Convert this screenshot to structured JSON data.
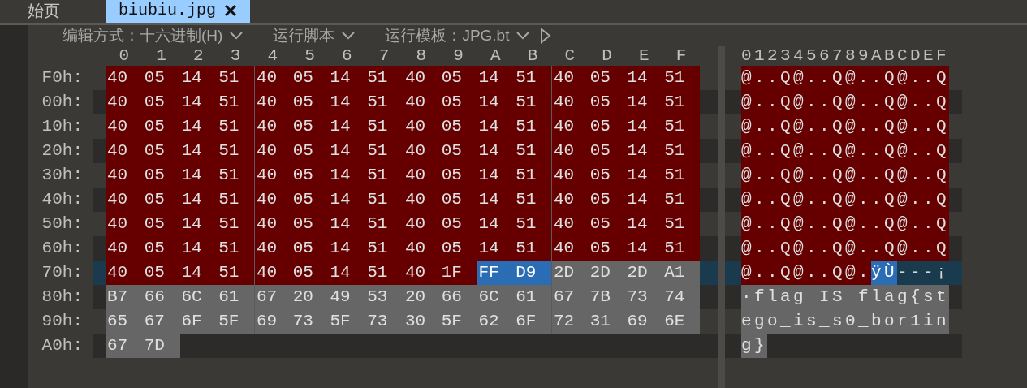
{
  "tabs": [
    {
      "label": "始页",
      "selected": false,
      "closable": false
    },
    {
      "label": "biubiu.jpg",
      "selected": true,
      "closable": true
    }
  ],
  "toolbar": [
    {
      "label": "编辑方式：十六进制(H)",
      "dropdown": true
    },
    {
      "label": "运行脚本",
      "dropdown": true
    },
    {
      "label": "运行模板：JPG.bt",
      "dropdown": true
    }
  ],
  "hex_header": [
    "0",
    "1",
    "2",
    "3",
    "4",
    "5",
    "6",
    "7",
    "8",
    "9",
    "A",
    "B",
    "C",
    "D",
    "E",
    "F"
  ],
  "ascii_header": "0123456789ABCDEF",
  "rows": [
    {
      "offset": "F0h:",
      "current": false,
      "hex": [
        {
          "kind": "template",
          "bytes": [
            "40",
            "05",
            "14",
            "51",
            "40",
            "05",
            "14",
            "51",
            "40",
            "05",
            "14",
            "51",
            "40",
            "05",
            "14",
            "51"
          ]
        }
      ],
      "ascii": [
        {
          "kind": "template",
          "text": "@..Q@..Q@..Q@..Q"
        }
      ]
    },
    {
      "offset": "00h:",
      "current": false,
      "hex": [
        {
          "kind": "template",
          "bytes": [
            "40",
            "05",
            "14",
            "51",
            "40",
            "05",
            "14",
            "51",
            "40",
            "05",
            "14",
            "51",
            "40",
            "05",
            "14",
            "51"
          ]
        }
      ],
      "ascii": [
        {
          "kind": "template",
          "text": "@..Q@..Q@..Q@..Q"
        }
      ]
    },
    {
      "offset": "10h:",
      "current": false,
      "hex": [
        {
          "kind": "template",
          "bytes": [
            "40",
            "05",
            "14",
            "51",
            "40",
            "05",
            "14",
            "51",
            "40",
            "05",
            "14",
            "51",
            "40",
            "05",
            "14",
            "51"
          ]
        }
      ],
      "ascii": [
        {
          "kind": "template",
          "text": "@..Q@..Q@..Q@..Q"
        }
      ]
    },
    {
      "offset": "20h:",
      "current": false,
      "hex": [
        {
          "kind": "template",
          "bytes": [
            "40",
            "05",
            "14",
            "51",
            "40",
            "05",
            "14",
            "51",
            "40",
            "05",
            "14",
            "51",
            "40",
            "05",
            "14",
            "51"
          ]
        }
      ],
      "ascii": [
        {
          "kind": "template",
          "text": "@..Q@..Q@..Q@..Q"
        }
      ]
    },
    {
      "offset": "30h:",
      "current": false,
      "hex": [
        {
          "kind": "template",
          "bytes": [
            "40",
            "05",
            "14",
            "51",
            "40",
            "05",
            "14",
            "51",
            "40",
            "05",
            "14",
            "51",
            "40",
            "05",
            "14",
            "51"
          ]
        }
      ],
      "ascii": [
        {
          "kind": "template",
          "text": "@..Q@..Q@..Q@..Q"
        }
      ]
    },
    {
      "offset": "40h:",
      "current": false,
      "hex": [
        {
          "kind": "template",
          "bytes": [
            "40",
            "05",
            "14",
            "51",
            "40",
            "05",
            "14",
            "51",
            "40",
            "05",
            "14",
            "51",
            "40",
            "05",
            "14",
            "51"
          ]
        }
      ],
      "ascii": [
        {
          "kind": "template",
          "text": "@..Q@..Q@..Q@..Q"
        }
      ]
    },
    {
      "offset": "50h:",
      "current": false,
      "hex": [
        {
          "kind": "template",
          "bytes": [
            "40",
            "05",
            "14",
            "51",
            "40",
            "05",
            "14",
            "51",
            "40",
            "05",
            "14",
            "51",
            "40",
            "05",
            "14",
            "51"
          ]
        }
      ],
      "ascii": [
        {
          "kind": "template",
          "text": "@..Q@..Q@..Q@..Q"
        }
      ]
    },
    {
      "offset": "60h:",
      "current": false,
      "hex": [
        {
          "kind": "template",
          "bytes": [
            "40",
            "05",
            "14",
            "51",
            "40",
            "05",
            "14",
            "51",
            "40",
            "05",
            "14",
            "51",
            "40",
            "05",
            "14",
            "51"
          ]
        }
      ],
      "ascii": [
        {
          "kind": "template",
          "text": "@..Q@..Q@..Q@..Q"
        }
      ]
    },
    {
      "offset": "70h:",
      "current": true,
      "hex": [
        {
          "kind": "template",
          "bytes": [
            "40",
            "05",
            "14",
            "51",
            "40",
            "05",
            "14",
            "51",
            "40",
            "1F"
          ]
        },
        {
          "kind": "selected",
          "bytes": [
            "FF",
            "D9"
          ]
        },
        {
          "kind": "plain",
          "bytes": [
            "2D",
            "2D",
            "2D",
            "A1"
          ]
        }
      ],
      "ascii": [
        {
          "kind": "template",
          "text": "@..Q@..Q@."
        },
        {
          "kind": "selected",
          "text": "ÿÙ"
        },
        {
          "kind": "unmarked",
          "text": "---¡"
        }
      ]
    },
    {
      "offset": "80h:",
      "current": false,
      "hex": [
        {
          "kind": "plain",
          "bytes": [
            "B7",
            "66",
            "6C",
            "61",
            "67",
            "20",
            "49",
            "53",
            "20",
            "66",
            "6C",
            "61",
            "67",
            "7B",
            "73",
            "74"
          ]
        }
      ],
      "ascii": [
        {
          "kind": "plain",
          "text": "·flag IS flag{st"
        }
      ]
    },
    {
      "offset": "90h:",
      "current": false,
      "hex": [
        {
          "kind": "plain",
          "bytes": [
            "65",
            "67",
            "6F",
            "5F",
            "69",
            "73",
            "5F",
            "73",
            "30",
            "5F",
            "62",
            "6F",
            "72",
            "31",
            "69",
            "6E"
          ]
        }
      ],
      "ascii": [
        {
          "kind": "plain",
          "text": "ego_is_s0_bor1in"
        }
      ]
    },
    {
      "offset": "A0h:",
      "current": false,
      "hex": [
        {
          "kind": "plain",
          "bytes": [
            "67",
            "7D"
          ]
        }
      ],
      "ascii": [
        {
          "kind": "plain",
          "text": "g}"
        }
      ]
    }
  ]
}
